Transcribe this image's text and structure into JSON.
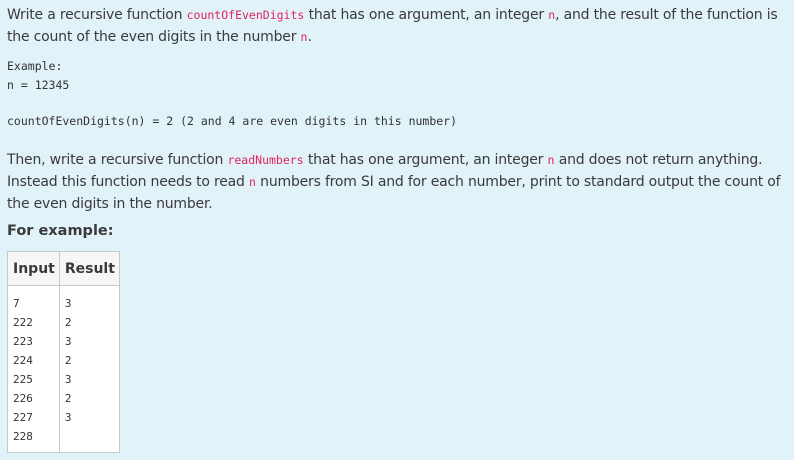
{
  "problem": {
    "p1_before": "Write a recursive function ",
    "p1_code1": "countOfEvenDigits",
    "p1_mid1": " that has one argument, an integer ",
    "p1_code2": "n",
    "p1_mid2": ", and the result of the function is the count of the even digits in the number ",
    "p1_code3": "n",
    "p1_end": ".",
    "example_label": "Example:",
    "example_n": "n = 12345",
    "example_call": "countOfEvenDigits(n) = 2 (2 and 4 are even digits in this number)",
    "p2_before": "Then, write a recursive function ",
    "p2_code1": "readNumbers",
    "p2_mid1": " that has one argument, an integer ",
    "p2_code2": "n",
    "p2_mid2": " and does not return anything. Instead this function needs to read ",
    "p2_code3": "n",
    "p2_end": " numbers from SI and for each number, print to standard output the count of the even digits in the number.",
    "for_example": "For example:"
  },
  "table": {
    "headers": [
      "Input",
      "Result"
    ],
    "input": "7\n222\n223\n224\n225\n226\n227\n228",
    "result": "3\n2\n3\n2\n3\n2\n3"
  }
}
